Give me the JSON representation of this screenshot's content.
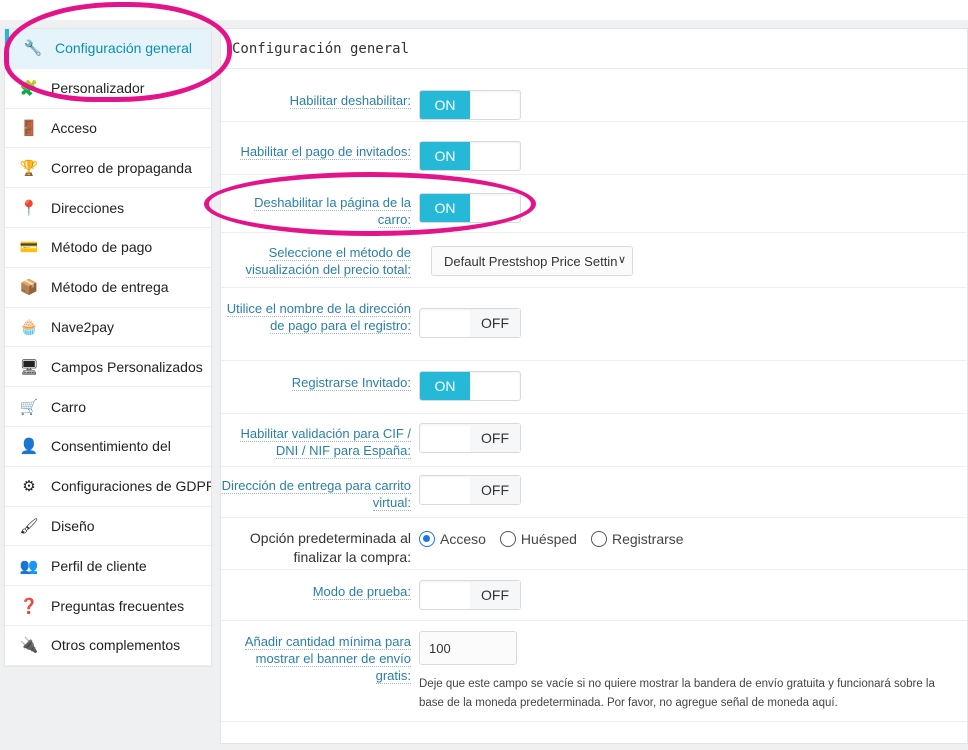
{
  "sidebar": {
    "items": [
      {
        "label": "Configuración general",
        "icon": "wrench-icon",
        "glyph": "🔧"
      },
      {
        "label": "Personalizador",
        "icon": "puzzle-icon",
        "glyph": "🧩"
      },
      {
        "label": "Acceso",
        "icon": "door-icon",
        "glyph": "🚪"
      },
      {
        "label": "Correo de propaganda",
        "icon": "trophy-icon",
        "glyph": "🏆"
      },
      {
        "label": "Direcciones",
        "icon": "location-pin-icon",
        "glyph": "📍"
      },
      {
        "label": "Método de pago",
        "icon": "payment-icon",
        "glyph": "💳"
      },
      {
        "label": "Método de entrega",
        "icon": "package-icon",
        "glyph": "📦"
      },
      {
        "label": "Nave2pay",
        "icon": "cupcake-icon",
        "glyph": "🧁"
      },
      {
        "label": "Campos Personalizados",
        "icon": "monitor-icon",
        "glyph": "🖥"
      },
      {
        "label": "Carro",
        "icon": "cart-icon",
        "glyph": "🛒"
      },
      {
        "label": "Consentimiento del",
        "icon": "user-consent-icon",
        "glyph": "👤"
      },
      {
        "label": "Configuraciones de GDPR",
        "icon": "gears-icon",
        "glyph": "⚙"
      },
      {
        "label": "Diseño",
        "icon": "brush-icon",
        "glyph": "🖌"
      },
      {
        "label": "Perfil de cliente",
        "icon": "profile-icon",
        "glyph": "👥"
      },
      {
        "label": "Preguntas frecuentes",
        "icon": "faq-icon",
        "glyph": "❓"
      },
      {
        "label": "Otros complementos",
        "icon": "plug-icon",
        "glyph": "🔌"
      }
    ]
  },
  "panel": {
    "title": "Configuración general",
    "rows": {
      "r1": {
        "label": "Habilitar deshabilitar:",
        "state": "ON"
      },
      "r2": {
        "label": "Habilitar el pago de invitados:",
        "state": "ON"
      },
      "r3": {
        "label": "Deshabilitar la página de la carro:",
        "state": "ON"
      },
      "r4": {
        "label": "Seleccione el método de visualización del precio total:",
        "value": "Default Prestshop Price Settin"
      },
      "r5": {
        "label": "Utilice el nombre de la dirección de pago para el registro:",
        "state": "OFF"
      },
      "r6": {
        "label": "Registrarse Invitado:",
        "state": "ON"
      },
      "r7": {
        "label": "Habilitar validación para CIF / DNI / NIF para España:",
        "state": "OFF"
      },
      "r8": {
        "label": "Dirección de entrega para carrito virtual:",
        "state": "OFF"
      },
      "r9": {
        "label": "Opción predeterminada al finalizar la compra:",
        "options": [
          "Acceso",
          "Huésped",
          "Registrarse"
        ],
        "selected": "Acceso"
      },
      "r10": {
        "label": "Modo de prueba:",
        "state": "OFF"
      },
      "r11": {
        "label": "Añadir cantidad mínima para mostrar el banner de envío gratis:",
        "value": "100",
        "help": "Deje que este campo se vacíe si no quiere mostrar la bandera de envío gratuita y funcionará sobre la base de la moneda predeterminada. Por favor, no agregue señal de moneda aquí."
      }
    }
  },
  "colors": {
    "accent": "#25b9d7",
    "annotation": "#e3148a",
    "label": "#2b7fa6"
  }
}
